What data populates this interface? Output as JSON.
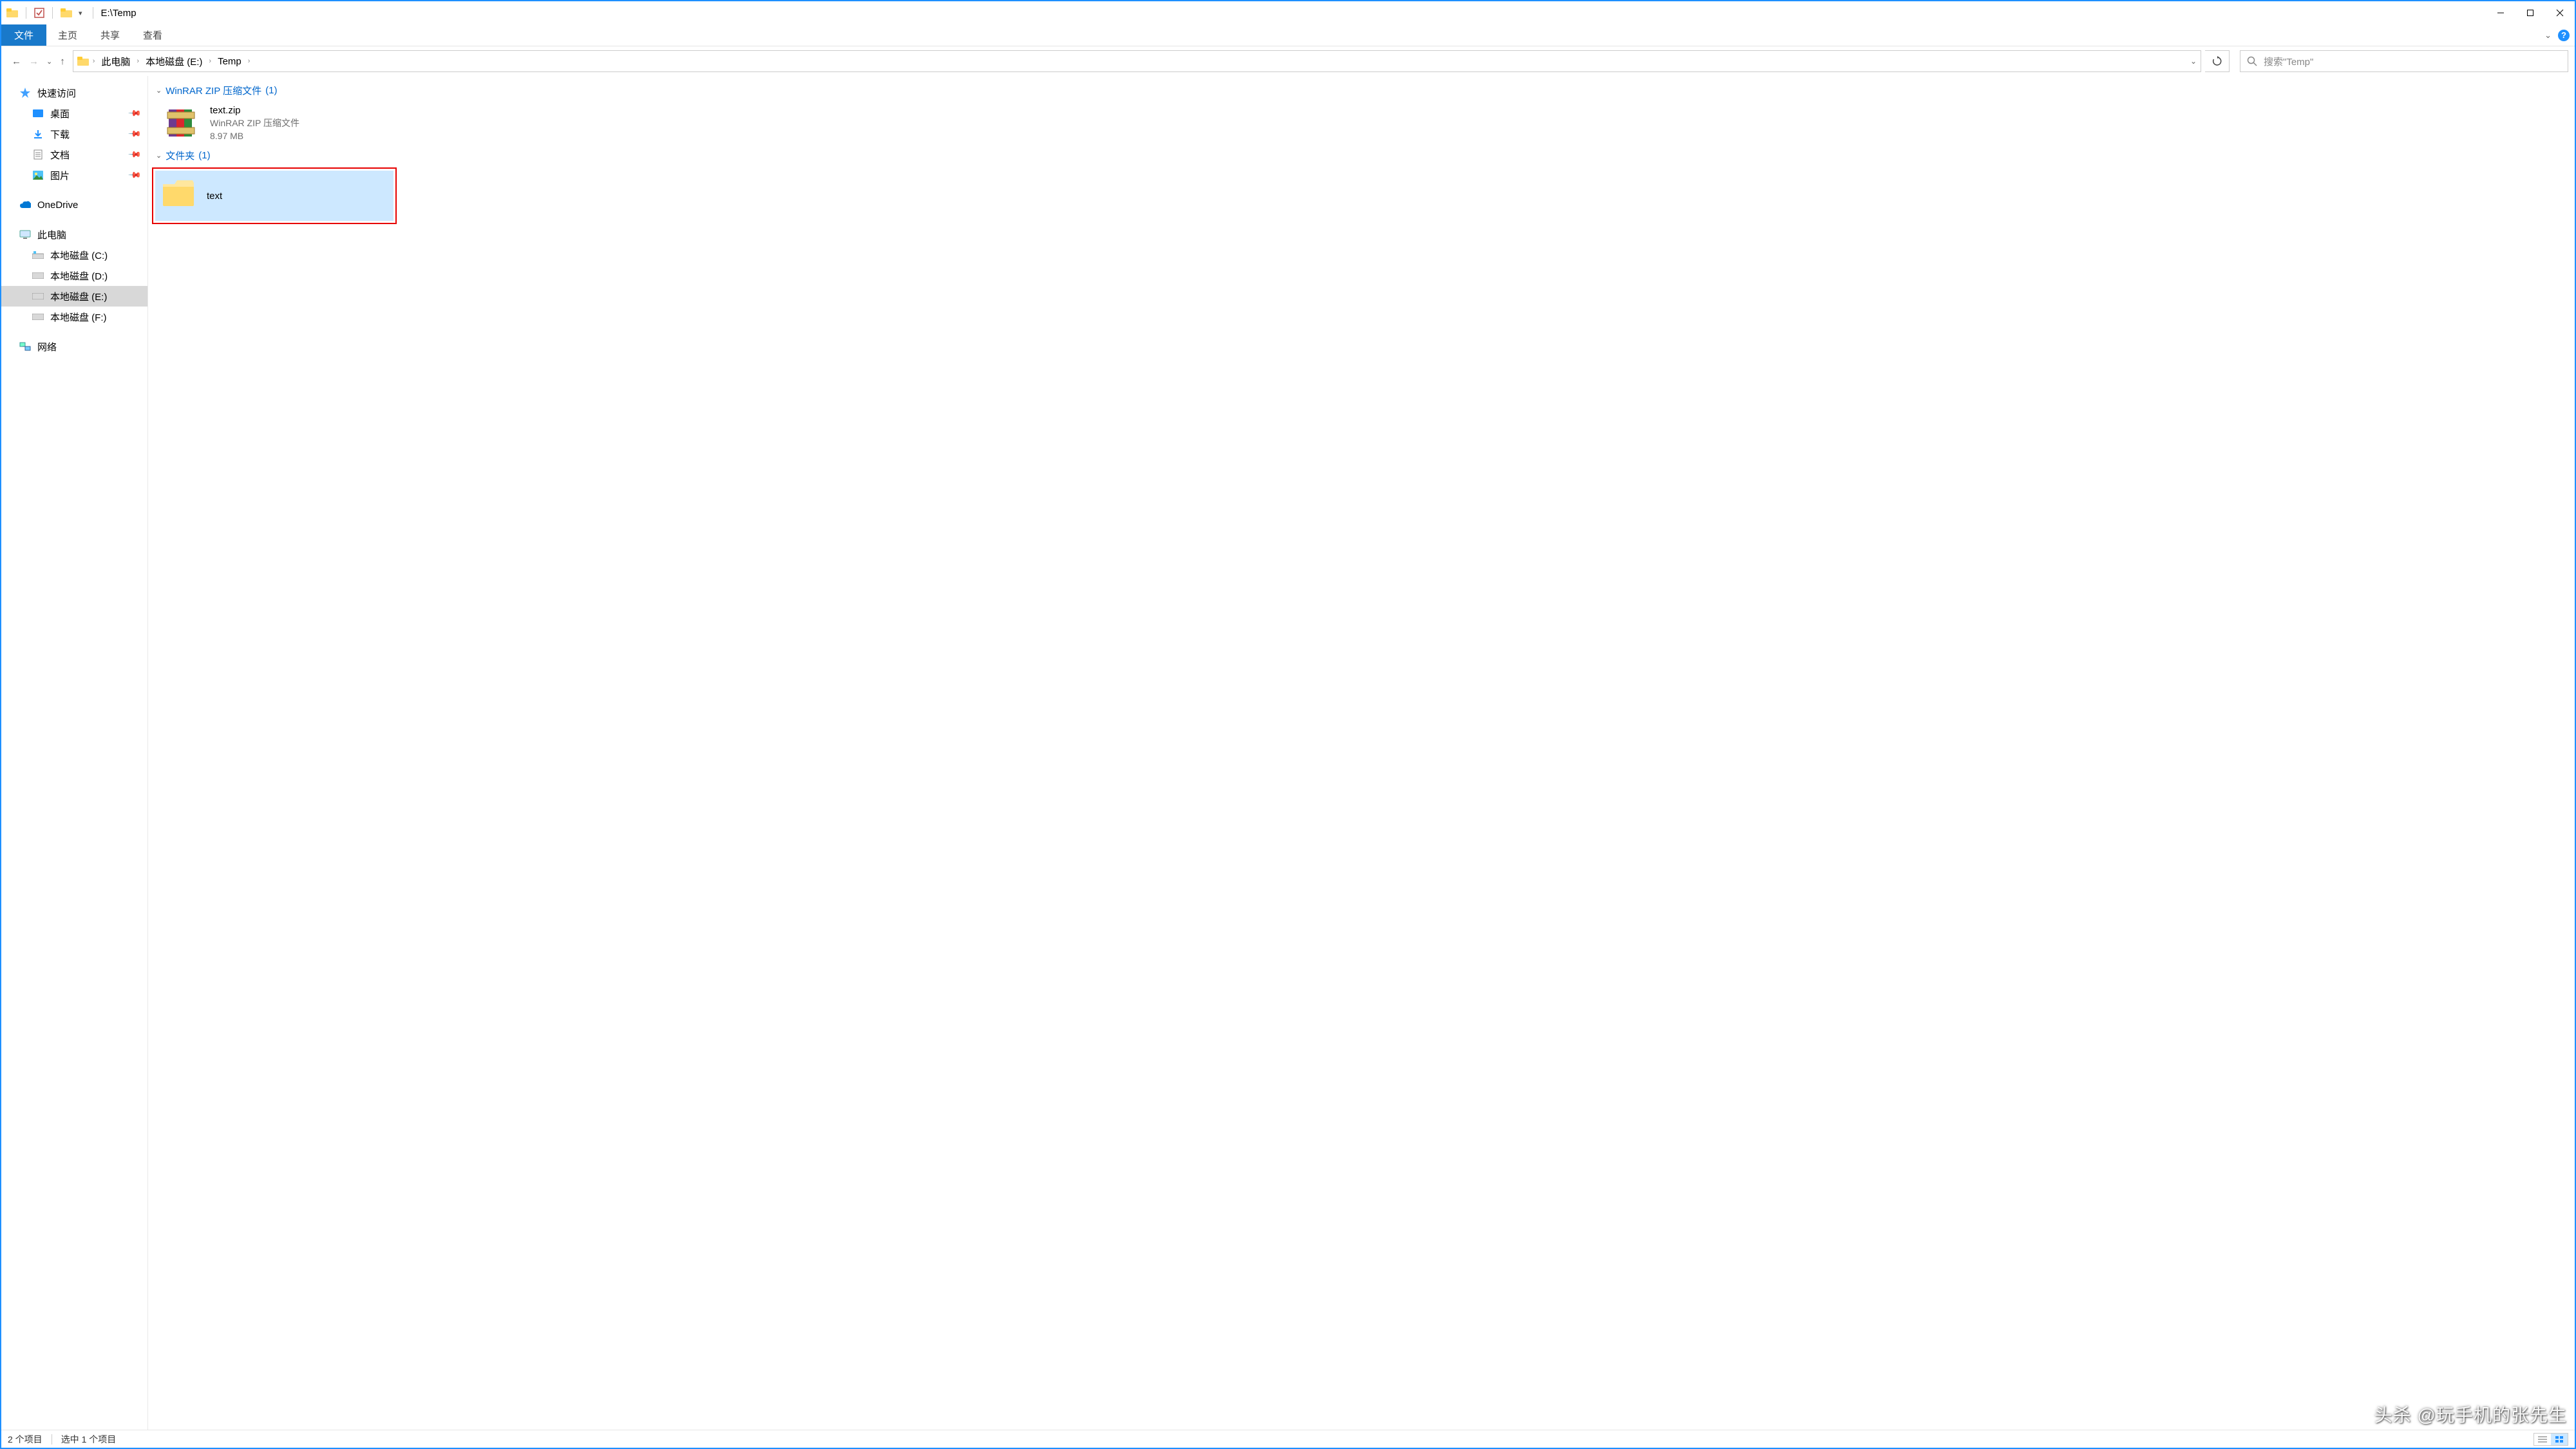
{
  "window": {
    "title": "E:\\Temp"
  },
  "ribbon": {
    "file": "文件",
    "tabs": [
      "主页",
      "共享",
      "查看"
    ]
  },
  "breadcrumbs": [
    "此电脑",
    "本地磁盘 (E:)",
    "Temp"
  ],
  "search": {
    "placeholder": "搜索\"Temp\""
  },
  "sidebar": {
    "quick_access": "快速访问",
    "quick_items": [
      {
        "label": "桌面"
      },
      {
        "label": "下载"
      },
      {
        "label": "文档"
      },
      {
        "label": "图片"
      }
    ],
    "onedrive": "OneDrive",
    "this_pc": "此电脑",
    "drives": [
      {
        "label": "本地磁盘 (C:)"
      },
      {
        "label": "本地磁盘 (D:)"
      },
      {
        "label": "本地磁盘 (E:)",
        "selected": true
      },
      {
        "label": "本地磁盘 (F:)"
      }
    ],
    "network": "网络"
  },
  "groups": {
    "zip": {
      "title": "WinRAR ZIP 压缩文件",
      "count": "(1)"
    },
    "folder": {
      "title": "文件夹",
      "count": "(1)"
    }
  },
  "files": {
    "zip": {
      "name": "text.zip",
      "type": "WinRAR ZIP 压缩文件",
      "size": "8.97 MB"
    },
    "folder": {
      "name": "text"
    }
  },
  "status": {
    "items": "2 个项目",
    "selected": "选中 1 个项目"
  },
  "watermark": "头杀 @玩手机的张先生"
}
